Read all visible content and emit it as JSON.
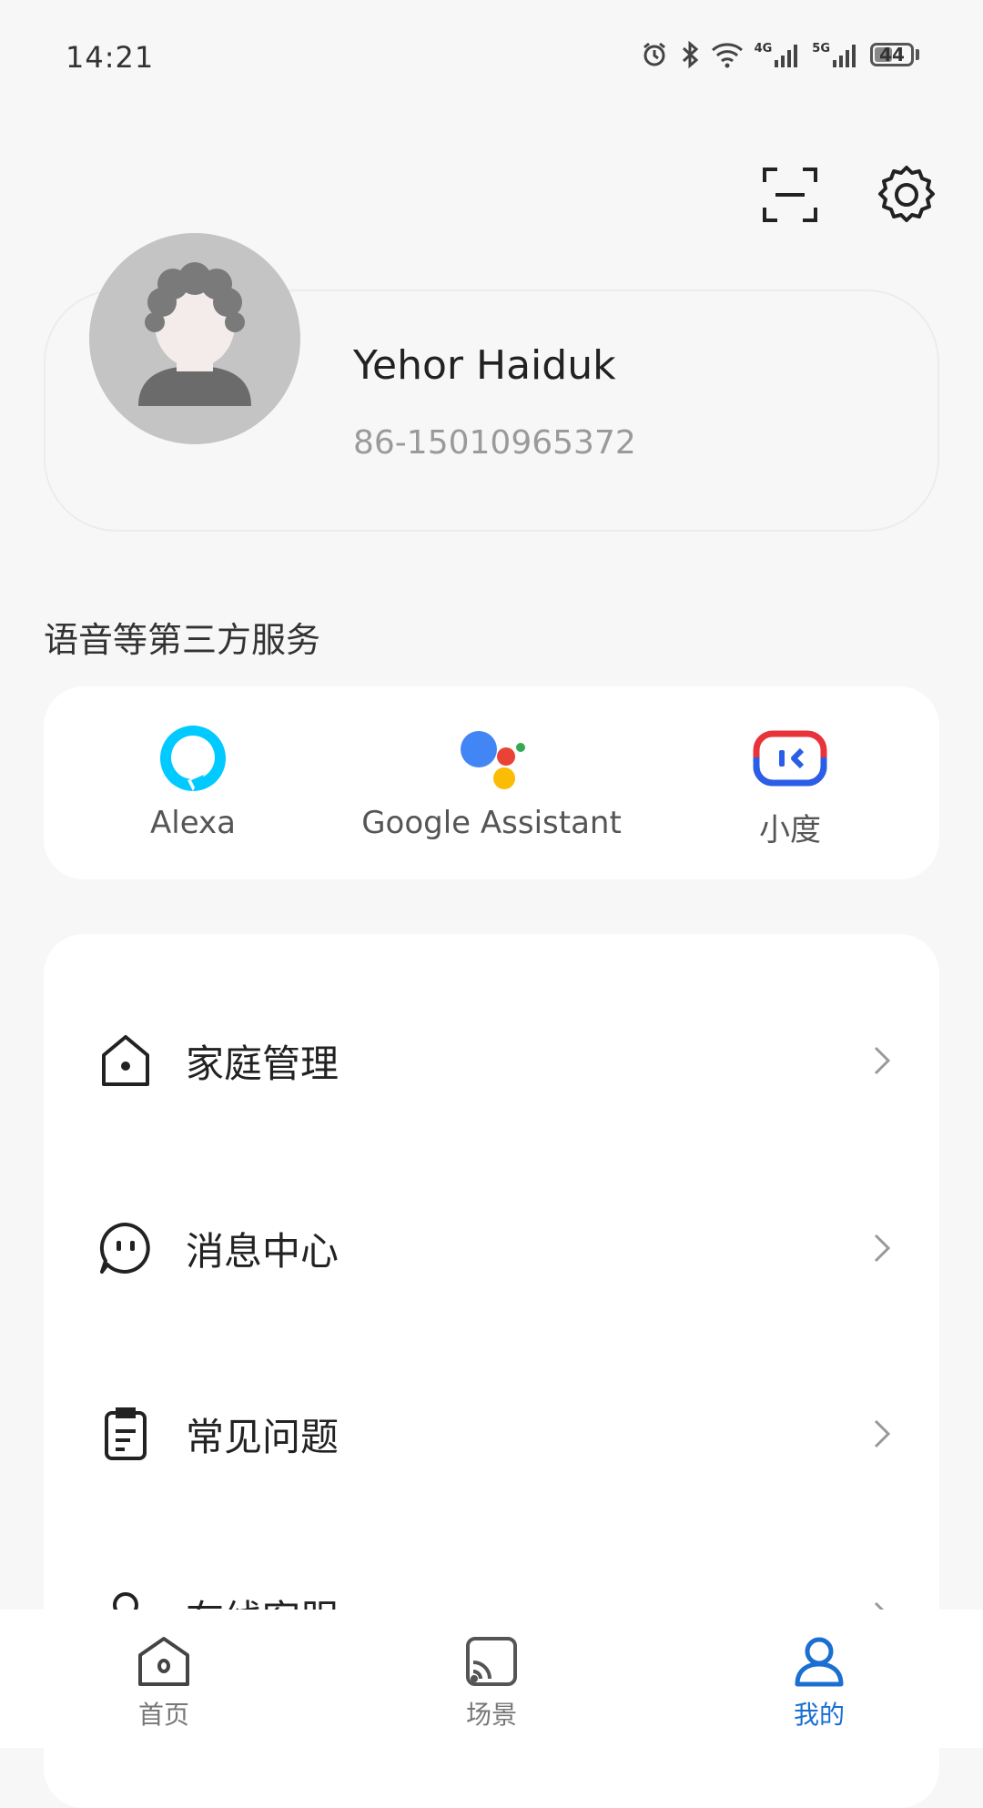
{
  "status_bar": {
    "time": "14:21",
    "network_1": "4G",
    "network_2": "5G",
    "battery": "44"
  },
  "header": {
    "scan_icon": "scan-icon",
    "settings_icon": "gear-icon"
  },
  "profile": {
    "name": "Yehor Haiduk",
    "phone": "86-15010965372"
  },
  "services": {
    "title": "语音等第三方服务",
    "items": [
      {
        "label": "Alexa",
        "icon": "alexa-icon"
      },
      {
        "label": "Google Assistant",
        "icon": "google-assistant-icon"
      },
      {
        "label": "小度",
        "icon": "xiaodu-icon"
      }
    ]
  },
  "menu": {
    "items": [
      {
        "label": "家庭管理",
        "icon": "home-icon"
      },
      {
        "label": "消息中心",
        "icon": "message-icon"
      },
      {
        "label": "常见问题",
        "icon": "clipboard-icon"
      },
      {
        "label": "在线客服",
        "icon": "person-icon"
      }
    ]
  },
  "bottom_nav": {
    "tabs": [
      {
        "label": "首页",
        "icon": "home-icon"
      },
      {
        "label": "场景",
        "icon": "cast-icon"
      },
      {
        "label": "我的",
        "icon": "user-icon",
        "active": true
      }
    ]
  },
  "colors": {
    "accent": "#1a6fd0",
    "background": "#f7f7f7",
    "alexa": "#00caff",
    "xiaodu_red": "#e8333a",
    "xiaodu_blue": "#2a5ee8"
  }
}
